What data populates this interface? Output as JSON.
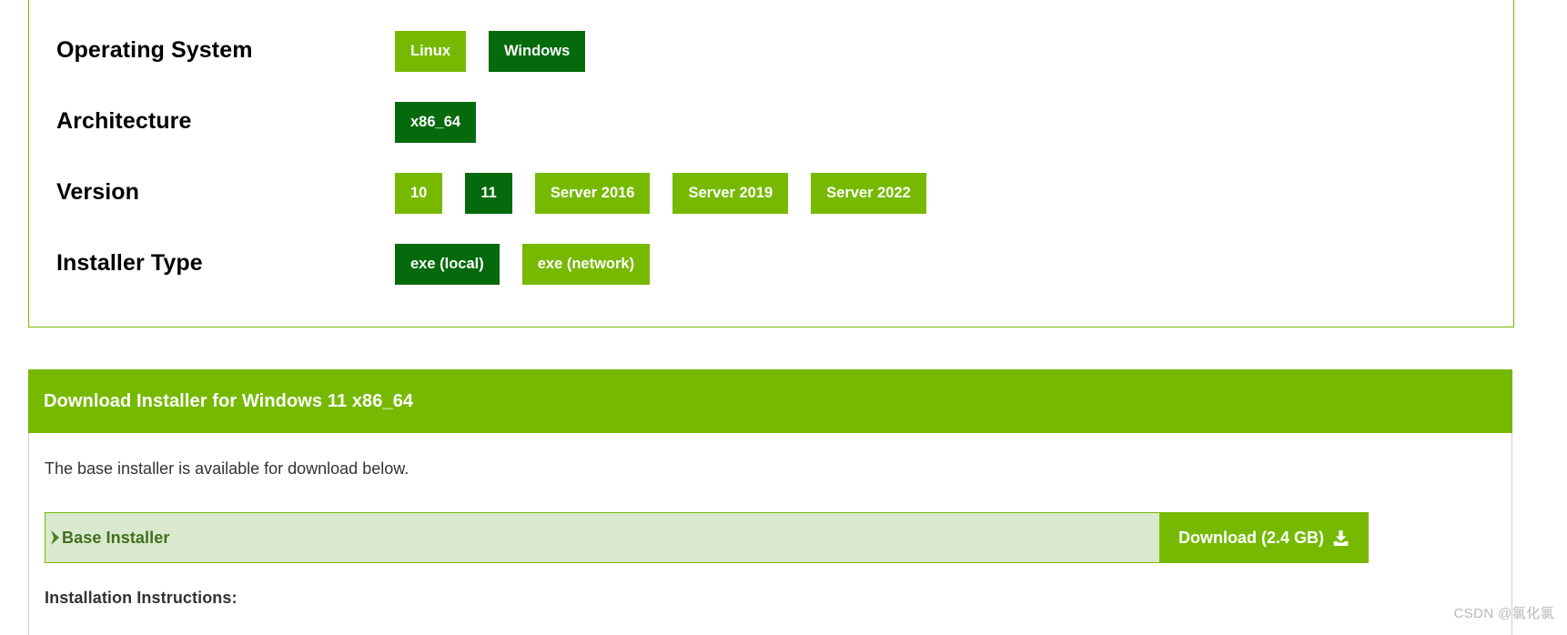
{
  "selector": {
    "rows": [
      {
        "label": "Operating System",
        "name": "operating-system",
        "options": [
          {
            "label": "Linux",
            "selected": false
          },
          {
            "label": "Windows",
            "selected": true
          }
        ]
      },
      {
        "label": "Architecture",
        "name": "architecture",
        "options": [
          {
            "label": "x86_64",
            "selected": true
          }
        ]
      },
      {
        "label": "Version",
        "name": "version",
        "options": [
          {
            "label": "10",
            "selected": false
          },
          {
            "label": "11",
            "selected": true
          },
          {
            "label": "Server 2016",
            "selected": false
          },
          {
            "label": "Server 2019",
            "selected": false
          },
          {
            "label": "Server 2022",
            "selected": false
          }
        ]
      },
      {
        "label": "Installer Type",
        "name": "installer-type",
        "options": [
          {
            "label": "exe (local)",
            "selected": true
          },
          {
            "label": "exe (network)",
            "selected": false
          }
        ]
      }
    ]
  },
  "download": {
    "header_title": "Download Installer for Windows 11 x86_64",
    "intro_text": "The base installer is available for download below.",
    "installer": {
      "chevron": "chevron-right-icon",
      "label": "Base Installer",
      "button_label": "Download (2.4 GB)",
      "button_icon": "download-icon"
    },
    "instructions_heading": "Installation Instructions:"
  },
  "watermark": "CSDN @氯化氯",
  "colors": {
    "brand_green": "#76b900",
    "selected_green": "#046a0b",
    "light_green_row": "#dae9cd",
    "installer_label_green": "#3f6f20"
  }
}
